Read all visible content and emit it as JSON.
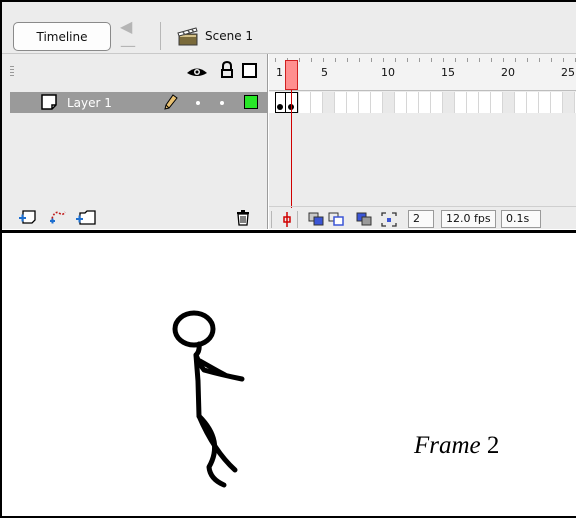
{
  "toolbar": {
    "timeline_label": "Timeline",
    "back_icon": "left-arrow-icon",
    "scene_icon": "clapperboard-icon",
    "scene_label": "Scene 1"
  },
  "layers": {
    "header_icons": [
      "eye-icon",
      "lock-icon",
      "outline-icon"
    ],
    "items": [
      {
        "name": "Layer 1",
        "selected": true,
        "outline_color": "#27e627"
      }
    ],
    "footer_icons": [
      "insert-layer-icon",
      "add-motion-guide-icon",
      "insert-layer-folder-icon",
      "trash-icon"
    ]
  },
  "frames": {
    "ruler_labels": [
      "1",
      "5",
      "10",
      "15",
      "20",
      "25"
    ],
    "current_frame": "2",
    "frame_rate": "12.0 fps",
    "elapsed_time": "0.1s",
    "playhead_color": "#ff8f8f"
  },
  "stage": {
    "caption_word": "Frame",
    "caption_number": " 2"
  }
}
